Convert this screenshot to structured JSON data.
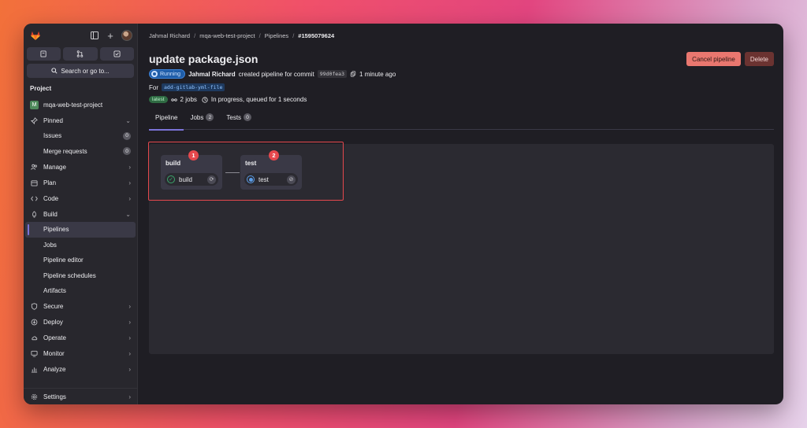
{
  "sidebar": {
    "search_label": "Search or go to...",
    "section": "Project",
    "project": {
      "initial": "M",
      "name": "mqa-web-test-project"
    },
    "pinned": {
      "label": "Pinned",
      "items": [
        {
          "label": "Issues",
          "count": "0"
        },
        {
          "label": "Merge requests",
          "count": "0"
        }
      ]
    },
    "nav": {
      "manage": "Manage",
      "plan": "Plan",
      "code": "Code",
      "build": "Build",
      "build_items": [
        "Pipelines",
        "Jobs",
        "Pipeline editor",
        "Pipeline schedules",
        "Artifacts"
      ],
      "secure": "Secure",
      "deploy": "Deploy",
      "operate": "Operate",
      "monitor": "Monitor",
      "analyze": "Analyze",
      "settings": "Settings"
    }
  },
  "breadcrumb": [
    "Jahmal Richard",
    "mqa-web-test-project",
    "Pipelines",
    "#1595079624"
  ],
  "header": {
    "title": "update package.json",
    "cancel_label": "Cancel pipeline",
    "delete_label": "Delete",
    "status": "Running",
    "author": "Jahmal Richard",
    "created_text": "created pipeline for commit",
    "commit": "99d0fea3",
    "time": "1 minute ago",
    "for_label": "For",
    "branch": "add-gitlab-yml-file",
    "latest_tag": "latest",
    "jobs_text": "2 jobs",
    "progress_text": "In progress, queued for 1 seconds"
  },
  "tabs": [
    {
      "label": "Pipeline",
      "count": ""
    },
    {
      "label": "Jobs",
      "count": "2"
    },
    {
      "label": "Tests",
      "count": "0"
    }
  ],
  "stages": [
    {
      "name": "build",
      "marker": "1",
      "job": "build",
      "status": "success"
    },
    {
      "name": "test",
      "marker": "2",
      "job": "test",
      "status": "running"
    }
  ],
  "colors": {
    "accent": "#7b73d8",
    "danger": "#e5484d",
    "success": "#3aa66b",
    "running": "#5b9de8"
  }
}
